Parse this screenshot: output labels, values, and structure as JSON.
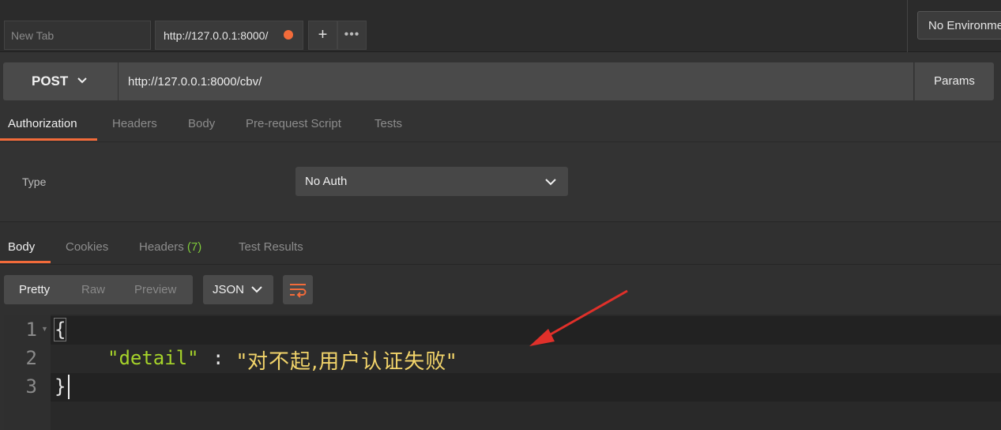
{
  "tabs": {
    "new_tab_placeholder": "New Tab",
    "active_tab_label": "http://127.0.0.1:8000/",
    "add_label": "+",
    "more_label": "•••",
    "unsaved_dot_color": "#f26b3a"
  },
  "environment": {
    "selected": "No Environment"
  },
  "request": {
    "method": "POST",
    "url": "http://127.0.0.1:8000/cbv/",
    "params_label": "Params"
  },
  "request_tabs": [
    {
      "label": "Authorization",
      "active": true
    },
    {
      "label": "Headers"
    },
    {
      "label": "Body"
    },
    {
      "label": "Pre-request Script"
    },
    {
      "label": "Tests"
    }
  ],
  "auth": {
    "type_label": "Type",
    "selected": "No Auth"
  },
  "response_tabs": {
    "body": "Body",
    "cookies": "Cookies",
    "headers": "Headers",
    "headers_count": "(7)",
    "test_results": "Test Results"
  },
  "response_view": {
    "modes": [
      "Pretty",
      "Raw",
      "Preview"
    ],
    "active_mode": "Pretty",
    "format": "JSON"
  },
  "editor": {
    "line_numbers": [
      "1",
      "2",
      "3"
    ],
    "brace_open": "{",
    "key": "\"detail\"",
    "colon": ":",
    "value": "\"对不起,用户认证失败\"",
    "brace_close": "}"
  },
  "colors": {
    "accent": "#f26b3a",
    "json_key": "#a6d32a",
    "json_string": "#f2d46a",
    "headers_count": "#7ec93a",
    "annotation_arrow": "#e0302a"
  },
  "icons": [
    "chevron-down-icon",
    "wrap-text-icon",
    "arrow-annotation"
  ]
}
